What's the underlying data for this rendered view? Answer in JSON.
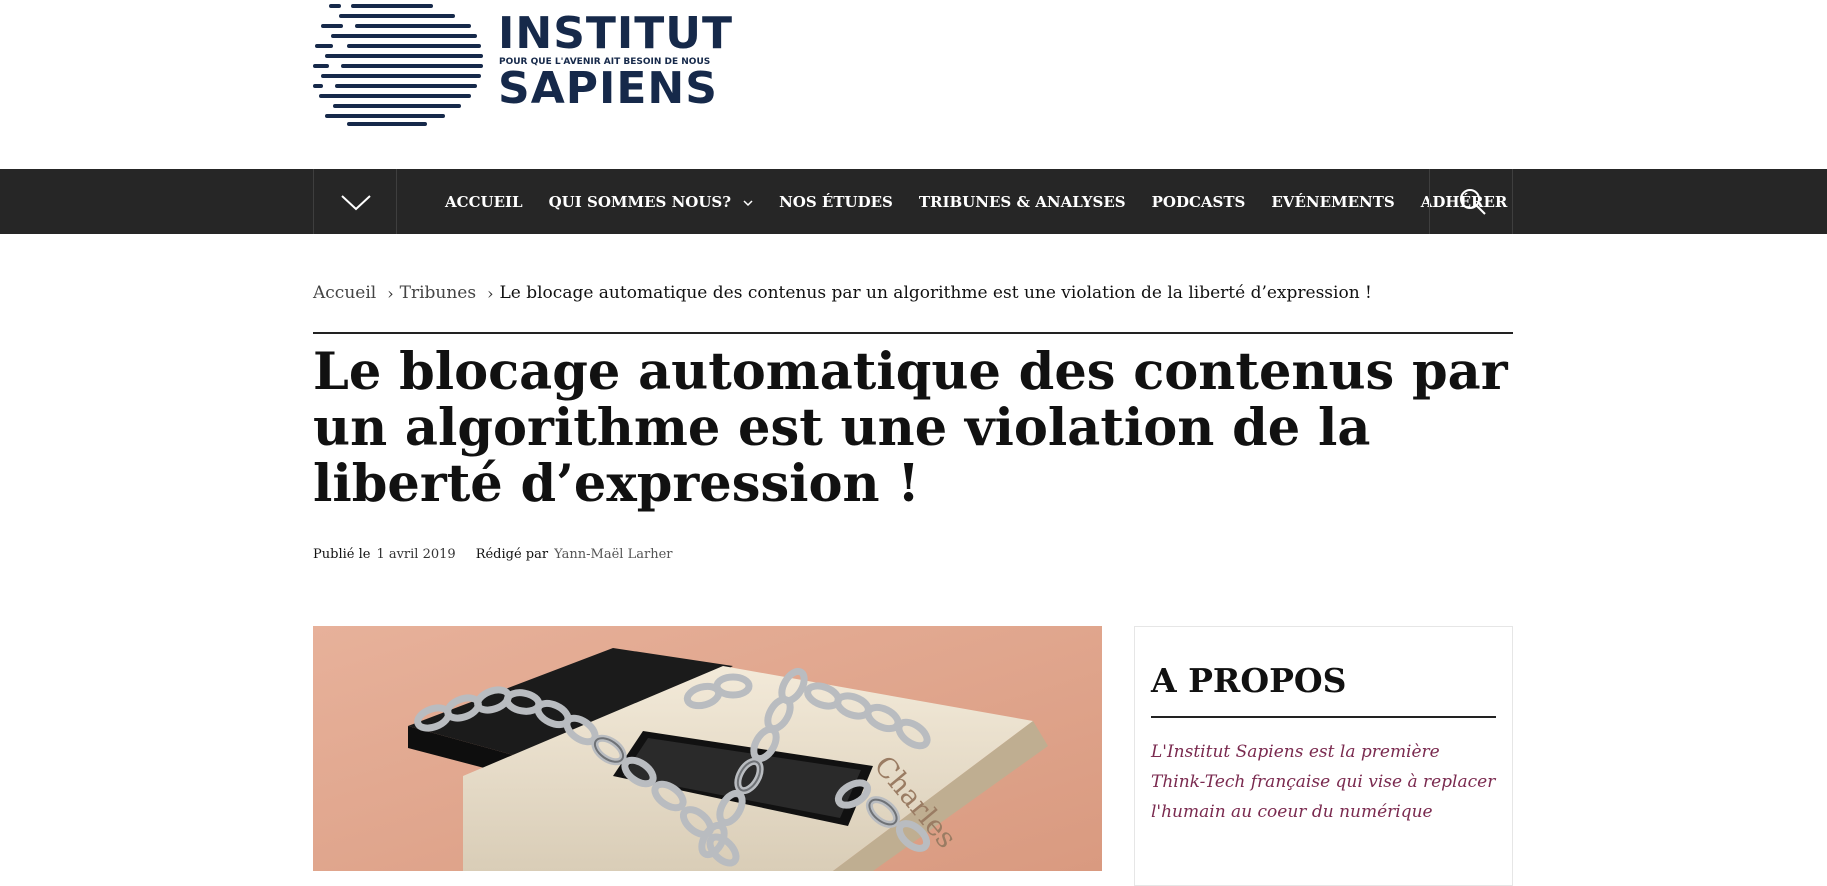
{
  "brand": {
    "name_top": "INSTITUT",
    "tagline": "POUR QUE L'AVENIR AIT BESOIN DE NOUS",
    "name_bottom": "SAPIENS",
    "color": "#16294a"
  },
  "nav": {
    "menu_icon": "chevron-down-icon",
    "items": [
      {
        "label": "ACCUEIL"
      },
      {
        "label": "QUI SOMMES NOUS?",
        "has_dropdown": true
      },
      {
        "label": "NOS ÉTUDES"
      },
      {
        "label": "TRIBUNES & ANALYSES"
      },
      {
        "label": "PODCASTS"
      },
      {
        "label": "EVÉNEMENTS"
      },
      {
        "label": "ADHÉRER"
      }
    ],
    "search_icon": "search-icon",
    "background": "#262626"
  },
  "breadcrumb": {
    "home": "Accueil",
    "section": "Tribunes",
    "current": "Le blocage automatique des contenus par un algorithme est une violation de la liberté d’expression !"
  },
  "article": {
    "title": "Le blocage automatique des contenus par un algorithme est une violation de la liberté d’expression !",
    "published_label": "Publié le",
    "published_date": "1 avril 2019",
    "author_label": "Rédigé par",
    "author": "Yann-Maël Larher"
  },
  "featured_image": {
    "description_icon": "chained-book-phone-image",
    "book_text": "Charles"
  },
  "sidebar": {
    "title": "A PROPOS",
    "text": "L'Institut Sapiens est la première Think-Tech française qui vise à replacer l'humain au coeur du numérique",
    "text_color": "#7a2a4f"
  }
}
